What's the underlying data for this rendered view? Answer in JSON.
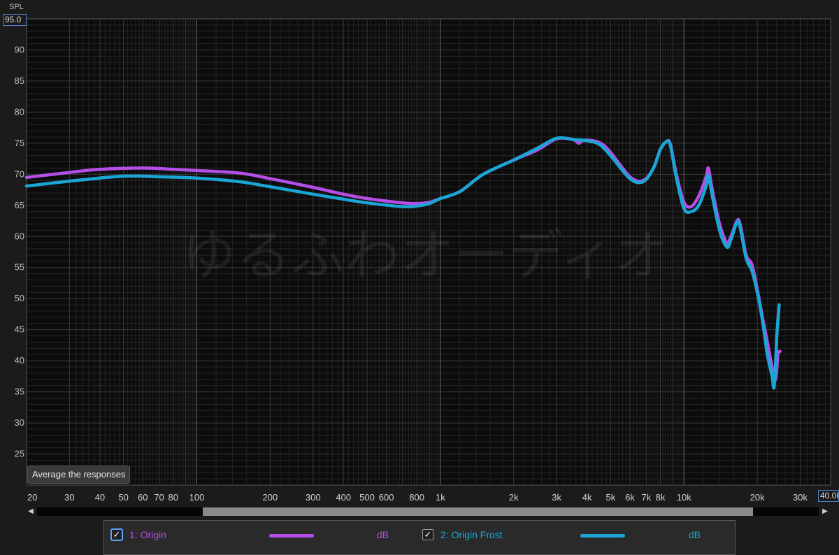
{
  "colors": {
    "origin": "#b44ee6",
    "origin_frost": "#1aa6d4",
    "plot_bg": "#0c0c0c"
  },
  "y_unit": "SPL",
  "y_max_value": "95.0",
  "x_max_value": "40.0k",
  "watermark_text": "ゆるふわオーディオ",
  "average_button_label": "Average the responses",
  "legend": {
    "items": [
      {
        "label": "1: Origin",
        "unit": "dB",
        "checked": true
      },
      {
        "label": "2: Origin Frost",
        "unit": "dB",
        "checked": true
      }
    ]
  },
  "chart_data": {
    "type": "line",
    "x_scale": "log",
    "xlim": [
      20,
      40000
    ],
    "ylim": [
      20,
      95
    ],
    "grid": true,
    "y_ticks": [
      25,
      30,
      35,
      40,
      45,
      50,
      55,
      60,
      65,
      70,
      75,
      80,
      85,
      90
    ],
    "x_ticks": [
      {
        "v": 20,
        "label": "20"
      },
      {
        "v": 30,
        "label": "30"
      },
      {
        "v": 40,
        "label": "40"
      },
      {
        "v": 50,
        "label": "50"
      },
      {
        "v": 60,
        "label": "60"
      },
      {
        "v": 70,
        "label": "70"
      },
      {
        "v": 80,
        "label": "80"
      },
      {
        "v": 100,
        "label": "100"
      },
      {
        "v": 200,
        "label": "200"
      },
      {
        "v": 300,
        "label": "300"
      },
      {
        "v": 400,
        "label": "400"
      },
      {
        "v": 500,
        "label": "500"
      },
      {
        "v": 600,
        "label": "600"
      },
      {
        "v": 800,
        "label": "800"
      },
      {
        "v": 1000,
        "label": "1k"
      },
      {
        "v": 2000,
        "label": "2k"
      },
      {
        "v": 3000,
        "label": "3k"
      },
      {
        "v": 4000,
        "label": "4k"
      },
      {
        "v": 5000,
        "label": "5k"
      },
      {
        "v": 6000,
        "label": "6k"
      },
      {
        "v": 7000,
        "label": "7k"
      },
      {
        "v": 8000,
        "label": "8k"
      },
      {
        "v": 10000,
        "label": "10k"
      },
      {
        "v": 20000,
        "label": "20k"
      },
      {
        "v": 30000,
        "label": "30k"
      }
    ],
    "series": [
      {
        "name": "1: Origin",
        "color": "#b44ee6",
        "points": [
          [
            20,
            69.5
          ],
          [
            30,
            70.3
          ],
          [
            40,
            70.8
          ],
          [
            60,
            71.0
          ],
          [
            80,
            70.8
          ],
          [
            100,
            70.6
          ],
          [
            150,
            70.2
          ],
          [
            200,
            69.3
          ],
          [
            300,
            67.9
          ],
          [
            400,
            66.8
          ],
          [
            500,
            66.1
          ],
          [
            700,
            65.4
          ],
          [
            800,
            65.3
          ],
          [
            900,
            65.5
          ],
          [
            1000,
            66.1
          ],
          [
            1200,
            67.2
          ],
          [
            1500,
            70.0
          ],
          [
            2000,
            72.3
          ],
          [
            2500,
            73.9
          ],
          [
            3000,
            75.7
          ],
          [
            3500,
            75.6
          ],
          [
            3700,
            75.0
          ],
          [
            3900,
            75.5
          ],
          [
            4500,
            75.1
          ],
          [
            5000,
            73.5
          ],
          [
            6000,
            69.6
          ],
          [
            6800,
            69.0
          ],
          [
            7500,
            71.0
          ],
          [
            8000,
            74.0
          ],
          [
            8500,
            75.3
          ],
          [
            8800,
            74.8
          ],
          [
            9300,
            70.0
          ],
          [
            10000,
            65.5
          ],
          [
            10700,
            64.8
          ],
          [
            11500,
            66.5
          ],
          [
            12300,
            69.5
          ],
          [
            12600,
            71.0
          ],
          [
            13000,
            68.0
          ],
          [
            14000,
            62.0
          ],
          [
            15000,
            59.0
          ],
          [
            15600,
            60.0
          ],
          [
            16500,
            62.5
          ],
          [
            17000,
            62.0
          ],
          [
            18000,
            57.0
          ],
          [
            19000,
            55.5
          ],
          [
            20000,
            51.5
          ],
          [
            21000,
            47.0
          ],
          [
            22000,
            43.0
          ],
          [
            23000,
            39.0
          ],
          [
            23800,
            37.0
          ],
          [
            24300,
            41.0
          ],
          [
            24800,
            41.5
          ]
        ]
      },
      {
        "name": "2: Origin Frost",
        "color": "#1aa6d4",
        "points": [
          [
            20,
            68.1
          ],
          [
            30,
            68.9
          ],
          [
            40,
            69.4
          ],
          [
            50,
            69.7
          ],
          [
            60,
            69.7
          ],
          [
            70,
            69.6
          ],
          [
            100,
            69.4
          ],
          [
            150,
            68.8
          ],
          [
            200,
            68.0
          ],
          [
            300,
            66.8
          ],
          [
            400,
            66.0
          ],
          [
            500,
            65.4
          ],
          [
            700,
            64.8
          ],
          [
            800,
            64.9
          ],
          [
            900,
            65.3
          ],
          [
            1000,
            66.1
          ],
          [
            1200,
            67.2
          ],
          [
            1500,
            70.0
          ],
          [
            2000,
            72.3
          ],
          [
            2500,
            74.2
          ],
          [
            3000,
            75.8
          ],
          [
            3500,
            75.6
          ],
          [
            4000,
            75.4
          ],
          [
            4500,
            74.8
          ],
          [
            5000,
            73.0
          ],
          [
            6000,
            69.3
          ],
          [
            6800,
            68.8
          ],
          [
            7500,
            71.0
          ],
          [
            8000,
            74.0
          ],
          [
            8500,
            75.3
          ],
          [
            8800,
            74.6
          ],
          [
            9300,
            69.5
          ],
          [
            10000,
            64.5
          ],
          [
            10700,
            64.0
          ],
          [
            11500,
            65.0
          ],
          [
            12300,
            68.0
          ],
          [
            12600,
            69.8
          ],
          [
            13000,
            67.0
          ],
          [
            14000,
            61.0
          ],
          [
            15000,
            58.3
          ],
          [
            15600,
            59.5
          ],
          [
            16500,
            62.3
          ],
          [
            17000,
            61.5
          ],
          [
            18000,
            56.5
          ],
          [
            19000,
            54.5
          ],
          [
            20000,
            51.0
          ],
          [
            21000,
            46.5
          ],
          [
            22000,
            41.0
          ],
          [
            23000,
            37.5
          ],
          [
            23400,
            35.6
          ],
          [
            23700,
            38.5
          ],
          [
            24100,
            44.5
          ],
          [
            24600,
            49.0
          ]
        ]
      }
    ]
  }
}
